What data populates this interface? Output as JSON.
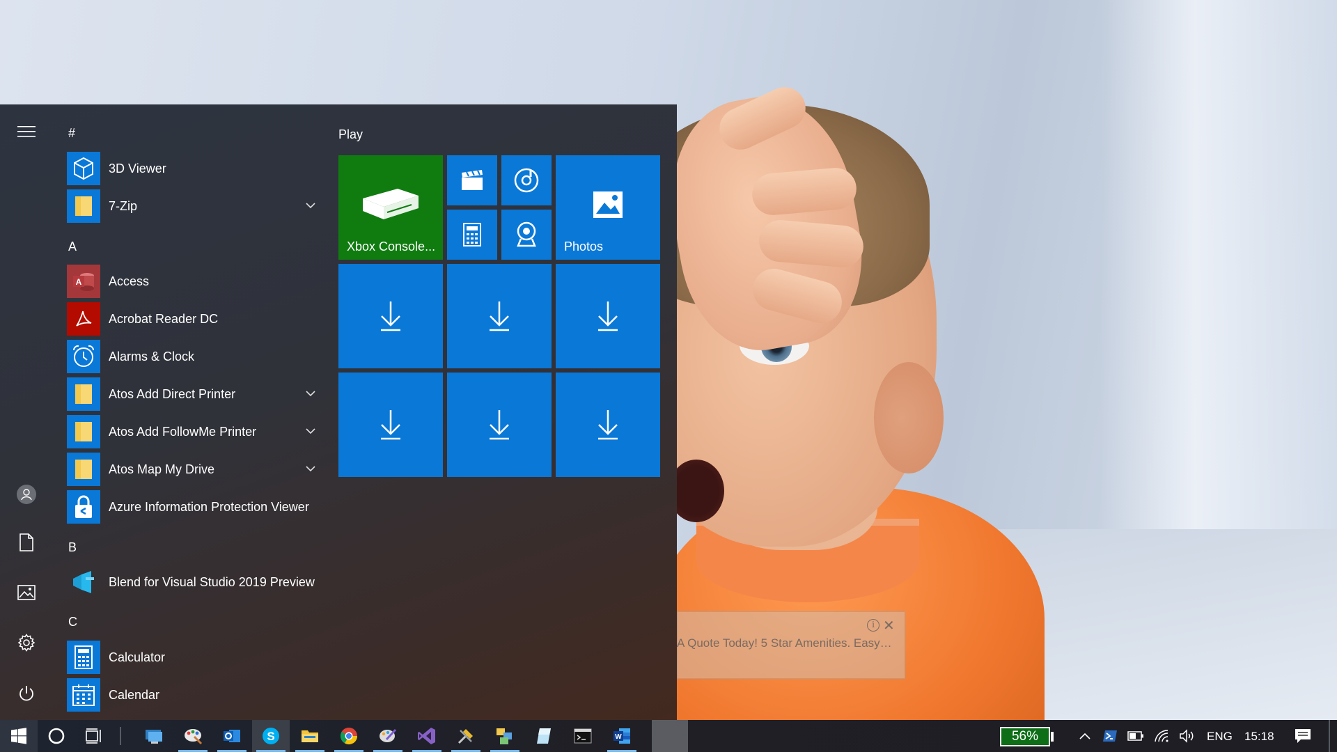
{
  "ad": {
    "text": "A Quote Today! 5 Star Amenities. Easy…",
    "info_glyph": "i",
    "close_glyph": "✕"
  },
  "start_menu": {
    "letters": {
      "hash": "#",
      "a": "A",
      "b": "B",
      "c": "C"
    },
    "apps": [
      {
        "name": "3D Viewer",
        "icon": "cube-icon",
        "expandable": false
      },
      {
        "name": "7-Zip",
        "icon": "folder-icon",
        "expandable": true
      },
      {
        "name": "Access",
        "icon": "access-icon",
        "expandable": false
      },
      {
        "name": "Acrobat Reader DC",
        "icon": "acrobat-icon",
        "expandable": false
      },
      {
        "name": "Alarms & Clock",
        "icon": "alarm-clock-icon",
        "expandable": false
      },
      {
        "name": "Atos Add Direct Printer",
        "icon": "folder-icon",
        "expandable": true
      },
      {
        "name": "Atos Add FollowMe Printer",
        "icon": "folder-icon",
        "expandable": true
      },
      {
        "name": "Atos Map My Drive",
        "icon": "folder-icon",
        "expandable": true
      },
      {
        "name": "Azure Information Protection Viewer",
        "icon": "lock-icon",
        "expandable": false
      },
      {
        "name": "Blend for Visual Studio 2019 Preview",
        "icon": "blend-icon",
        "expandable": false
      },
      {
        "name": "Calculator",
        "icon": "calculator-icon",
        "expandable": false
      },
      {
        "name": "Calendar",
        "icon": "calendar-icon",
        "expandable": false
      }
    ],
    "tile_group": {
      "title": "Play",
      "xbox_label": "Xbox Console...",
      "photos_label": "Photos"
    },
    "rail": [
      "hamburger-icon",
      "user-icon",
      "document-icon",
      "pictures-icon",
      "settings-icon",
      "power-icon"
    ]
  },
  "taskbar": {
    "battery_percent": "56%",
    "language": "ENG",
    "time": "15:18",
    "colors": {
      "accent": "#0a78d7",
      "battery_fill": "#0d6e17"
    }
  }
}
